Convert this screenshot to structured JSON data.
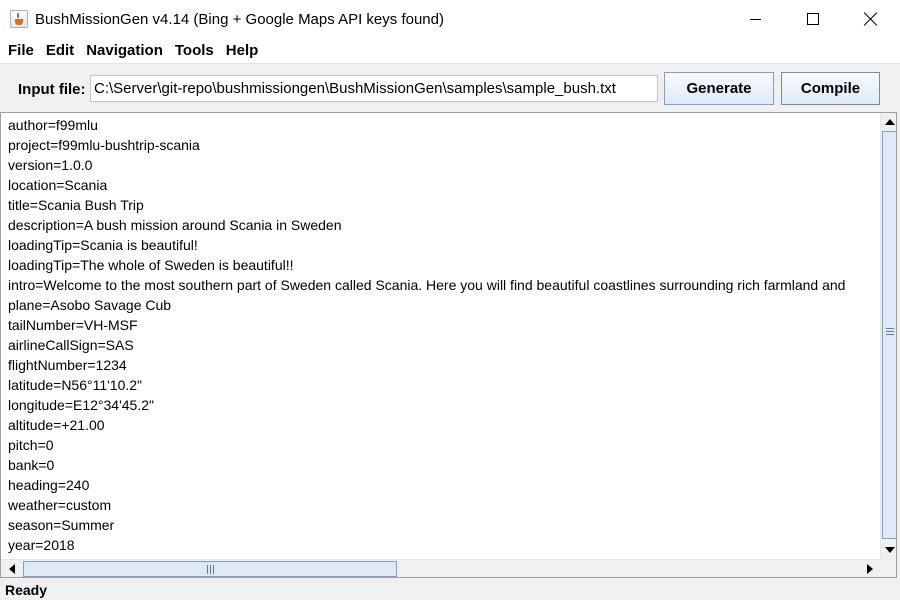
{
  "window": {
    "title": "BushMissionGen v4.14 (Bing + Google Maps API keys found)"
  },
  "menu": [
    "File",
    "Edit",
    "Navigation",
    "Tools",
    "Help"
  ],
  "input": {
    "label": "Input file:",
    "value": "C:\\Server\\git-repo\\bushmissiongen\\BushMissionGen\\samples\\sample_bush.txt"
  },
  "buttons": {
    "generate": "Generate",
    "compile": "Compile"
  },
  "editor": {
    "lines": [
      "author=f99mlu",
      "project=f99mlu-bushtrip-scania",
      "version=1.0.0",
      "location=Scania",
      "title=Scania Bush Trip",
      "description=A bush mission around Scania in Sweden",
      "loadingTip=Scania is beautiful!",
      "loadingTip=The whole of Sweden is beautiful!!",
      "intro=Welcome to the most southern part of Sweden called Scania. Here you will find beautiful coastlines surrounding rich farmland and",
      "plane=Asobo Savage Cub",
      "tailNumber=VH-MSF",
      "airlineCallSign=SAS",
      "flightNumber=1234",
      "latitude=N56°11'10.2\"",
      "longitude=E12°34'45.2\"",
      "altitude=+21.00",
      "pitch=0",
      "bank=0",
      "heading=240",
      "weather=custom",
      "season=Summer",
      "year=2018"
    ]
  },
  "status": {
    "text": "Ready"
  },
  "colors": {
    "accent": "#7ba1cc",
    "button_top": "#f7fbff",
    "button_bottom": "#dfe9f5"
  }
}
